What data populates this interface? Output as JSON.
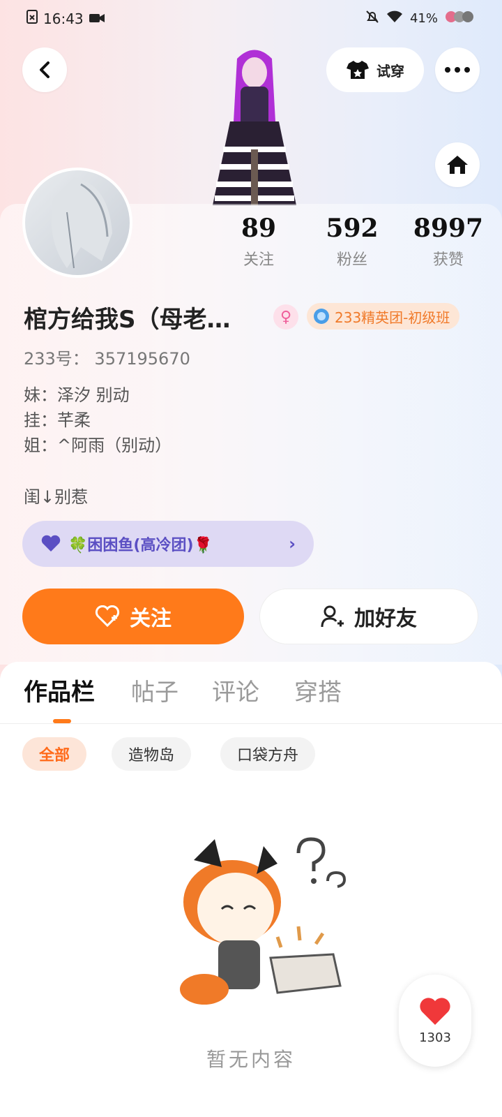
{
  "status_bar": {
    "time": "16:43",
    "battery": "41%"
  },
  "top_actions": {
    "try_on_label": "试穿"
  },
  "stats": [
    {
      "value": "89",
      "label": "关注"
    },
    {
      "value": "592",
      "label": "粉丝"
    },
    {
      "value": "8997",
      "label": "获赞"
    }
  ],
  "profile": {
    "name": "棺方给我S（母老…",
    "gender_symbol": "♀",
    "badge": "233精英团-初级班",
    "id_line": "233号：  357195670",
    "bio_lines": [
      "妹：泽汐 别动",
      "挂：芊柔",
      "姐：^阿雨（别动）",
      "闺↓别惹"
    ]
  },
  "group": {
    "label": "🍀困困鱼(高冷团)🌹"
  },
  "buttons": {
    "follow": "关注",
    "add_friend": "加好友"
  },
  "tabs": [
    "作品栏",
    "帖子",
    "评论",
    "穿搭"
  ],
  "chips": [
    "全部",
    "造物岛",
    "口袋方舟"
  ],
  "empty_text": "暂无内容",
  "like_count": "1303",
  "colors": {
    "accent": "#ff7a1a",
    "group_bg": "#ded9f4",
    "badge_text": "#f07a2a"
  }
}
